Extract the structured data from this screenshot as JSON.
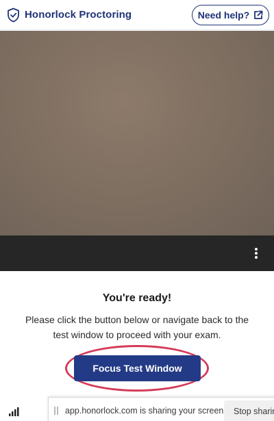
{
  "header": {
    "brand_name": "Honorlock Proctoring",
    "help_label": "Need help?"
  },
  "main": {
    "title": "You're ready!",
    "message": "Please click the button below or navigate back to the test window to proceed with your exam.",
    "focus_button_label": "Focus Test Window"
  },
  "share_bar": {
    "message": "app.honorlock.com is sharing your screen.",
    "stop_label": "Stop sharing"
  },
  "colors": {
    "brand": "#1f3277",
    "primary_button": "#233b86",
    "highlight_ring": "#d43c5a",
    "video_bar": "#262626"
  },
  "icons": {
    "brand": "shield-check-icon",
    "help": "external-link-icon",
    "menu": "kebab-menu-icon",
    "signal": "signal-bars-icon",
    "drag": "drag-handle-icon"
  }
}
